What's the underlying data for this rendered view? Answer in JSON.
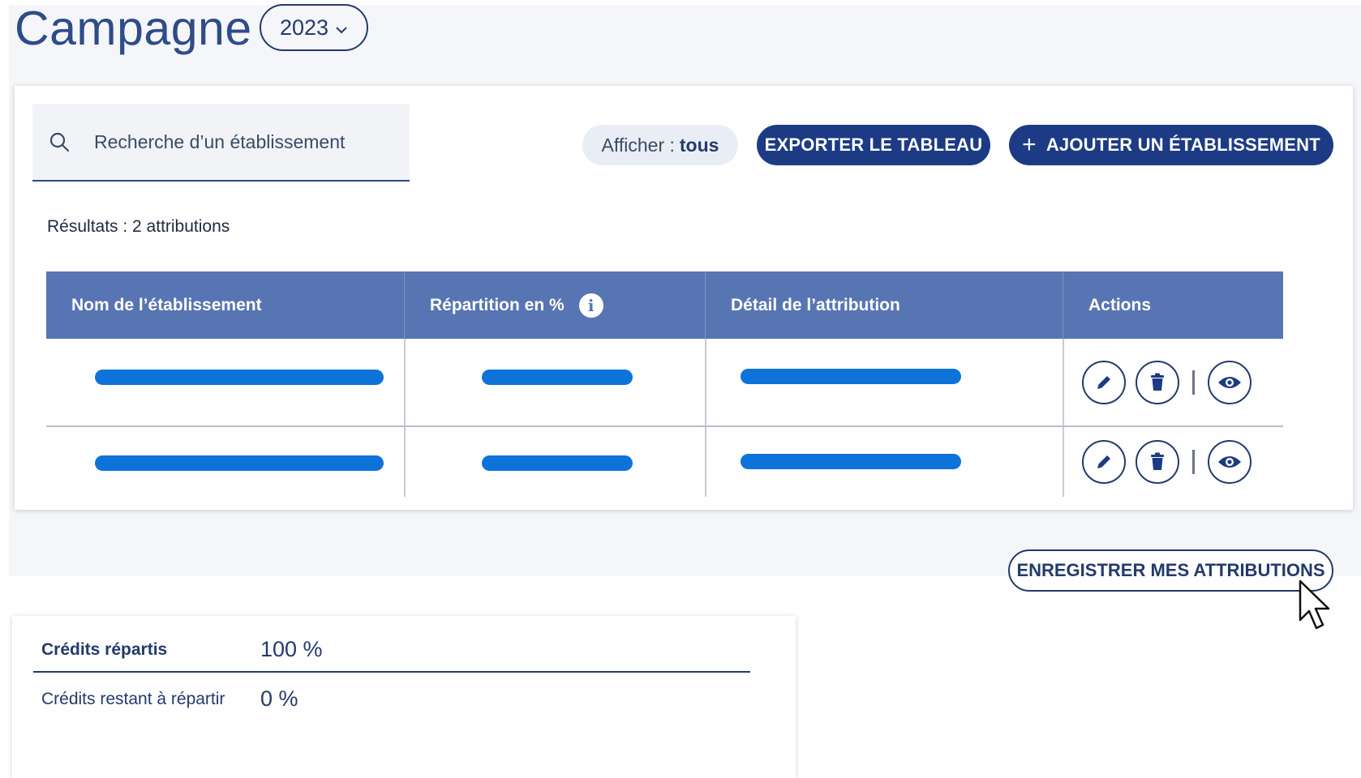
{
  "page": {
    "title": "Campagne",
    "year_selected": "2023"
  },
  "toolbar": {
    "search_placeholder": "Recherche d’un établissement",
    "filter_label": "Afficher :",
    "filter_value": "tous",
    "export_label": "EXPORTER LE TABLEAU",
    "add_label": "AJOUTER UN ÉTABLISSEMENT"
  },
  "results": {
    "text": "Résultats : 2 attributions"
  },
  "table": {
    "columns": [
      "Nom de l’établissement",
      "Répartition en %",
      "Détail de l’attribution",
      "Actions"
    ],
    "row_count": 2,
    "row_actions": [
      "edit-icon",
      "trash-icon",
      "eye-icon"
    ]
  },
  "save": {
    "label": "ENREGISTRER MES ATTRIBUTIONS"
  },
  "credits": {
    "distributed_label": "Crédits répartis",
    "distributed_value": "100 %",
    "remaining_label": "Crédits restant à répartir",
    "remaining_value": "0 %"
  },
  "colors": {
    "primary": "#1d3b84",
    "table_header": "#5875b3",
    "placeholder_bar": "#0d73d9",
    "page_band": "#f5f6fa"
  }
}
